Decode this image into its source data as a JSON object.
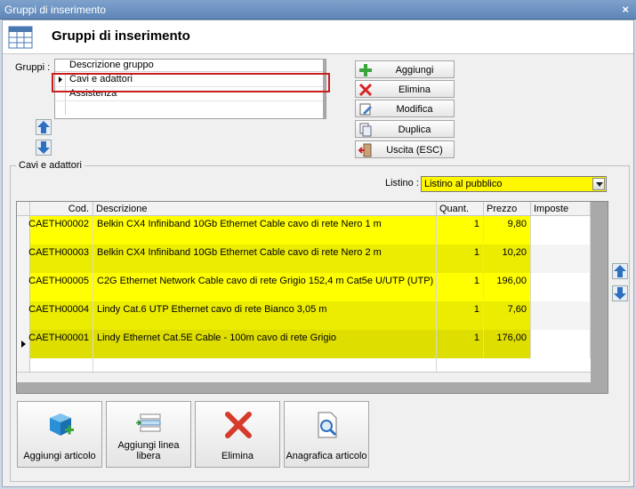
{
  "window": {
    "title": "Gruppi di inserimento",
    "close": "×"
  },
  "header": {
    "title": "Gruppi di inserimento"
  },
  "groups": {
    "label": "Gruppi :",
    "column_header": "Descrizione gruppo",
    "items": [
      "Cavi e adattori",
      "Assistenza"
    ]
  },
  "actions": {
    "add": "Aggiungi",
    "delete": "Elimina",
    "edit": "Modifica",
    "duplicate": "Duplica",
    "exit": "Uscita (ESC)"
  },
  "detail": {
    "group_title": "Cavi e adattori",
    "listino_label": "Listino :",
    "listino_value": "Listino al pubblico",
    "columns": [
      "Cod.",
      "Descrizione",
      "Quant.",
      "Prezzo",
      "Imposte"
    ],
    "rows": [
      {
        "code": "CAETH00002",
        "desc": "Belkin CX4 Infiniband 10Gb Ethernet Cable cavo di rete Nero 1 m",
        "qty": "1",
        "price": "9,80",
        "tax": ""
      },
      {
        "code": "CAETH00003",
        "desc": "Belkin CX4 Infiniband 10Gb Ethernet Cable cavo di rete Nero 2 m",
        "qty": "1",
        "price": "10,20",
        "tax": ""
      },
      {
        "code": "CAETH00005",
        "desc": "C2G Ethernet Network Cable cavo di rete Grigio 152,4 m Cat5e U/UTP (UTP)",
        "qty": "1",
        "price": "196,00",
        "tax": ""
      },
      {
        "code": "CAETH00004",
        "desc": "Lindy Cat.6 UTP Ethernet cavo di rete Bianco 3,05 m",
        "qty": "1",
        "price": "7,60",
        "tax": ""
      },
      {
        "code": "CAETH00001",
        "desc": "Lindy Ethernet Cat.5E Cable - 100m cavo di rete Grigio",
        "qty": "1",
        "price": "176,00",
        "tax": ""
      }
    ]
  },
  "bottom_buttons": {
    "add_item": "Aggiungi articolo",
    "add_free_line": "Aggiungi linea libera",
    "delete": "Elimina",
    "item_registry": "Anagrafica articolo"
  },
  "icons": {
    "header": "table-icon",
    "add": "plus-icon",
    "delete": "x-icon",
    "edit": "pencil-icon",
    "duplicate": "copy-icon",
    "exit": "exit-icon",
    "up": "arrow-up-icon",
    "down": "arrow-down-icon",
    "add_item": "cube-plus-icon",
    "add_free_line": "list-insert-icon",
    "registry": "magnifier-doc-icon"
  },
  "colors": {
    "highlight": "#ffff00",
    "selection_border": "#c81e1e",
    "accent": "#5f86b8"
  }
}
